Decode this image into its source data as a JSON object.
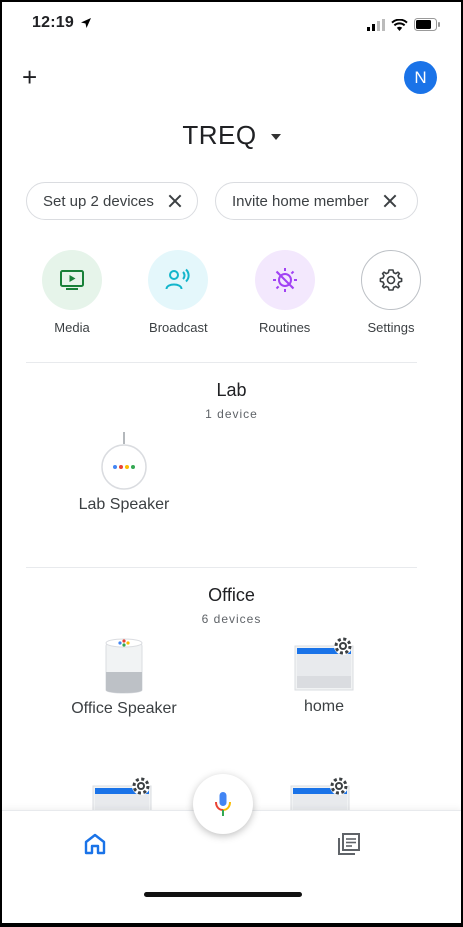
{
  "status": {
    "time": "12:19"
  },
  "header": {
    "add_symbol": "+",
    "avatar_initial": "N",
    "home_name": "TREQ"
  },
  "chips": [
    {
      "label": "Set up 2 devices"
    },
    {
      "label": "Invite home member"
    }
  ],
  "actions": [
    {
      "label": "Media",
      "icon": "media-icon",
      "bg": "#e6f4ea",
      "fg": "#188038"
    },
    {
      "label": "Broadcast",
      "icon": "broadcast-icon",
      "bg": "#e4f7fb",
      "fg": "#12b5cb"
    },
    {
      "label": "Routines",
      "icon": "routines-icon",
      "bg": "#f3e8fd",
      "fg": "#a142f4"
    },
    {
      "label": "Settings",
      "icon": "gear-icon",
      "bg": "#ffffff",
      "fg": "#5f6368"
    }
  ],
  "rooms": [
    {
      "name": "Lab",
      "count": "1 device",
      "devices": [
        {
          "name": "Lab Speaker",
          "icon": "mini-speaker-icon"
        }
      ]
    },
    {
      "name": "Office",
      "count": "6 devices",
      "devices": [
        {
          "name": "Office Speaker",
          "icon": "home-speaker-icon"
        },
        {
          "name": "home",
          "icon": "display-gear-icon"
        },
        {
          "name": "",
          "icon": "display-gear-icon"
        },
        {
          "name": "",
          "icon": "display-gear-icon"
        }
      ]
    }
  ],
  "nav": {
    "items": [
      {
        "icon": "home-icon",
        "active": true
      },
      {
        "icon": "feed-icon",
        "active": false
      }
    ]
  },
  "colors": {
    "accent": "#1a73e8"
  }
}
